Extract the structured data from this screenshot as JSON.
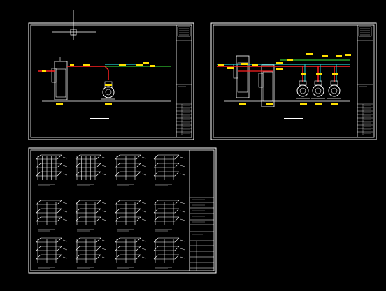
{
  "viewport": {
    "background": "#000000"
  },
  "colors": {
    "frame": "#ffffff",
    "pipe_red": "#ff2020",
    "pipe_cyan": "#20d0d0",
    "pipe_green": "#30c030",
    "tag_yellow": "#ffe000",
    "equipment": "#ffffff",
    "iso_pipe": "#ffffff",
    "cursor": "#ffffff"
  },
  "sheets": [
    {
      "id": "sheet-1",
      "kind": "single-unit-piping-elevation",
      "pumps": 1,
      "tanks": 1
    },
    {
      "id": "sheet-2",
      "kind": "multi-unit-piping-elevation",
      "pumps": 3,
      "tanks": 2
    },
    {
      "id": "sheet-3",
      "kind": "isometric-piping-details",
      "isometric_views": 12
    }
  ],
  "icons": {
    "crosshair": "crosshair-icon"
  }
}
